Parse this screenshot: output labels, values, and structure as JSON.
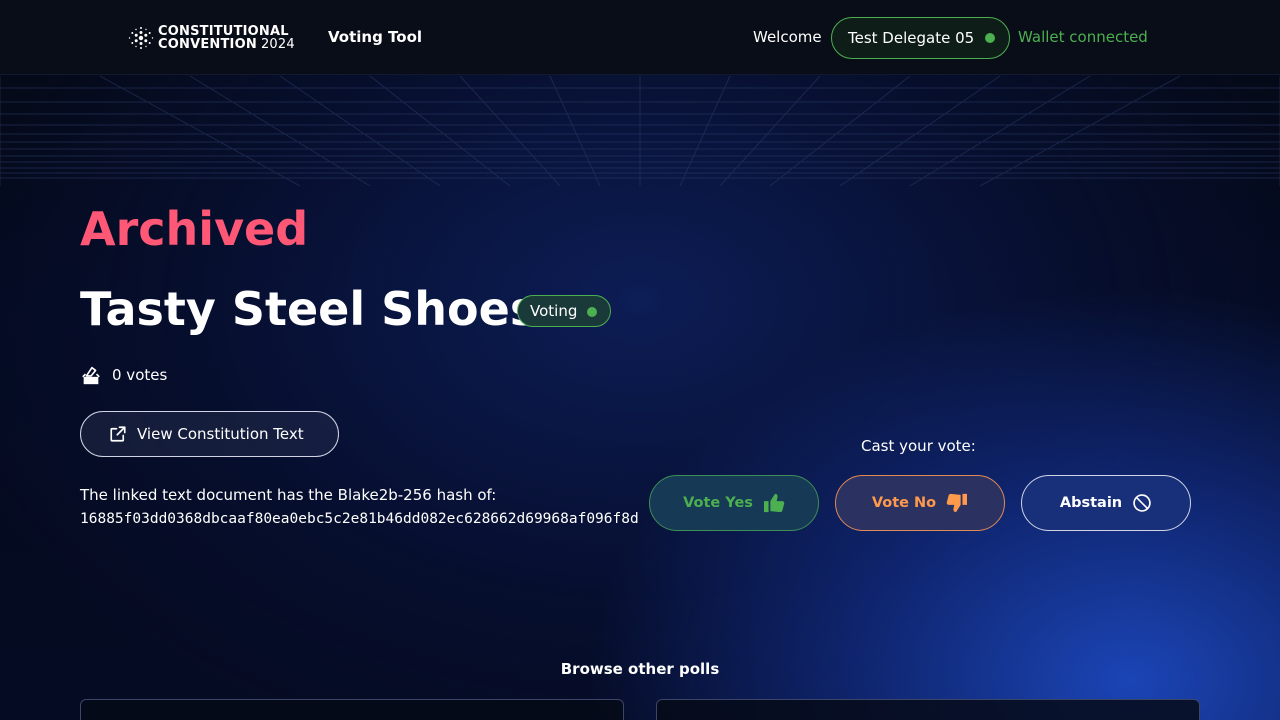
{
  "header": {
    "logo_line1": "CONSTITUTIONAL",
    "logo_line2": "CONVENTION",
    "logo_year": "2024",
    "nav_title": "Voting Tool",
    "welcome_label": "Welcome",
    "delegate_name": "Test Delegate 05",
    "wallet_status": "Wallet connected"
  },
  "poll": {
    "state_label": "Archived",
    "title": "Tasty Steel Shoes",
    "status_badge": "Voting",
    "votes_count": "0 votes",
    "view_button_label": "View Constitution Text",
    "hash_intro": "The linked text document has the Blake2b-256 hash of:",
    "hash_value": "16885f03dd0368dbcaaf80ea0ebc5c2e81b46dd082ec628662d69968af096f8d"
  },
  "vote": {
    "cast_label": "Cast your vote:",
    "yes_label": "Vote Yes",
    "no_label": "Vote No",
    "abstain_label": "Abstain"
  },
  "browse": {
    "title": "Browse other polls"
  },
  "colors": {
    "archived": "#ff5776",
    "connected": "#4caf50",
    "vote_no": "#ff9a4d"
  },
  "icons": {
    "logo": "cardano-logo-icon",
    "ballot": "ballot-box-icon",
    "external_link": "external-link-icon",
    "thumbs_up": "thumbs-up-icon",
    "thumbs_down": "thumbs-down-icon",
    "abstain": "ban-icon"
  }
}
